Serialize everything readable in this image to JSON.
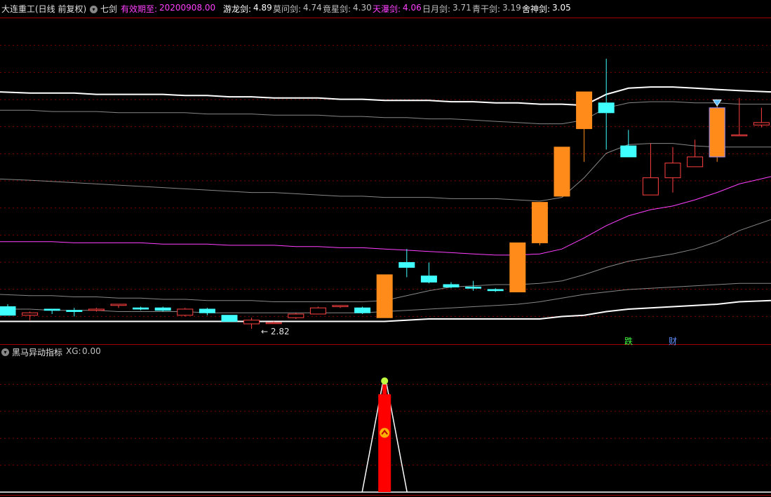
{
  "header": {
    "title": "大连重工(日线 前复权)",
    "indicator_name": "七剑",
    "valid_label": "有效期至:",
    "valid_date": "20200908.00",
    "swords": [
      {
        "label": "游龙剑:",
        "value": "4.89",
        "color": "#ffffff"
      },
      {
        "label": "莫问剑:",
        "value": "4.74",
        "color": "#c0c0c0"
      },
      {
        "label": "竟星剑:",
        "value": "4.30",
        "color": "#c0c0c0"
      },
      {
        "label": "天瀑剑:",
        "value": "4.06",
        "color": "#ff40ff"
      },
      {
        "label": "日月剑:",
        "value": "3.71",
        "color": "#c0c0c0"
      },
      {
        "label": "青干剑:",
        "value": "3.19",
        "color": "#c0c0c0"
      },
      {
        "label": "舍神剑:",
        "value": "3.05",
        "color": "#ffffff"
      }
    ]
  },
  "sub_header": {
    "title": "黑马异动指标",
    "xg_label": "XG:",
    "xg_value": "0.00"
  },
  "annotations": {
    "low_price": "2.82",
    "mark_die": "跌",
    "mark_cai": "财"
  },
  "colors": {
    "up": "#ff4040",
    "down": "#40ffff",
    "strong": "#ff8c1a",
    "magenta": "#ff40ff",
    "grid": "#800000",
    "signal": "#ff0000"
  },
  "chart_data": {
    "type": "candlestick",
    "price_range": [
      2.7,
      5.35
    ],
    "candles": [
      {
        "o": 3.0,
        "h": 3.02,
        "l": 2.93,
        "c": 2.93
      },
      {
        "o": 2.93,
        "h": 2.96,
        "l": 2.89,
        "c": 2.95
      },
      {
        "o": 2.98,
        "h": 2.98,
        "l": 2.94,
        "c": 2.97
      },
      {
        "o": 2.97,
        "h": 2.99,
        "l": 2.92,
        "c": 2.96
      },
      {
        "o": 2.97,
        "h": 2.99,
        "l": 2.96,
        "c": 2.98
      },
      {
        "o": 3.01,
        "h": 3.02,
        "l": 2.99,
        "c": 3.02
      },
      {
        "o": 2.99,
        "h": 3.0,
        "l": 2.97,
        "c": 2.98
      },
      {
        "o": 2.99,
        "h": 3.0,
        "l": 2.96,
        "c": 2.97
      },
      {
        "o": 2.93,
        "h": 2.99,
        "l": 2.92,
        "c": 2.98
      },
      {
        "o": 2.98,
        "h": 2.99,
        "l": 2.93,
        "c": 2.95
      },
      {
        "o": 2.93,
        "h": 2.93,
        "l": 2.88,
        "c": 2.88
      },
      {
        "o": 2.86,
        "h": 2.91,
        "l": 2.82,
        "c": 2.89
      },
      {
        "o": 2.87,
        "h": 2.88,
        "l": 2.86,
        "c": 2.87
      },
      {
        "o": 2.91,
        "h": 2.95,
        "l": 2.9,
        "c": 2.94
      },
      {
        "o": 2.94,
        "h": 3.0,
        "l": 2.94,
        "c": 2.99
      },
      {
        "o": 3.0,
        "h": 3.01,
        "l": 2.99,
        "c": 3.01
      },
      {
        "o": 2.99,
        "h": 3.0,
        "l": 2.94,
        "c": 2.95
      },
      {
        "o": 2.91,
        "h": 3.26,
        "l": 2.91,
        "c": 3.26
      },
      {
        "o": 3.36,
        "h": 3.47,
        "l": 3.24,
        "c": 3.32
      },
      {
        "o": 3.25,
        "h": 3.36,
        "l": 3.19,
        "c": 3.2
      },
      {
        "o": 3.18,
        "h": 3.2,
        "l": 3.15,
        "c": 3.16
      },
      {
        "o": 3.16,
        "h": 3.21,
        "l": 3.13,
        "c": 3.15
      },
      {
        "o": 3.14,
        "h": 3.15,
        "l": 3.12,
        "c": 3.13
      },
      {
        "o": 3.12,
        "h": 3.52,
        "l": 3.12,
        "c": 3.52
      },
      {
        "o": 3.52,
        "h": 3.85,
        "l": 3.5,
        "c": 3.85
      },
      {
        "o": 3.9,
        "h": 4.3,
        "l": 3.9,
        "c": 4.3
      },
      {
        "o": 4.45,
        "h": 4.75,
        "l": 4.18,
        "c": 4.75
      },
      {
        "o": 4.66,
        "h": 5.02,
        "l": 4.28,
        "c": 4.58
      },
      {
        "o": 4.31,
        "h": 4.44,
        "l": 4.22,
        "c": 4.22
      },
      {
        "o": 3.91,
        "h": 4.33,
        "l": 3.91,
        "c": 4.05
      },
      {
        "o": 4.05,
        "h": 4.3,
        "l": 3.93,
        "c": 4.17
      },
      {
        "o": 4.14,
        "h": 4.36,
        "l": 4.14,
        "c": 4.22
      },
      {
        "o": 4.22,
        "h": 4.64,
        "l": 4.18,
        "c": 4.62
      },
      {
        "o": 4.4,
        "h": 4.7,
        "l": 4.4,
        "c": 4.4
      },
      {
        "o": 4.48,
        "h": 4.62,
        "l": 4.46,
        "c": 4.5
      }
    ],
    "bands": [
      {
        "name": "游龙剑",
        "color": "#ffffff",
        "width": 2,
        "values": [
          4.75,
          4.74,
          4.74,
          4.74,
          4.73,
          4.73,
          4.73,
          4.73,
          4.72,
          4.72,
          4.71,
          4.71,
          4.7,
          4.7,
          4.7,
          4.69,
          4.69,
          4.68,
          4.68,
          4.68,
          4.67,
          4.67,
          4.66,
          4.66,
          4.65,
          4.65,
          4.64,
          4.73,
          4.78,
          4.79,
          4.79,
          4.78,
          4.77,
          4.76,
          4.75
        ]
      },
      {
        "name": "莫问剑",
        "color": "#c0c0c0",
        "width": 1,
        "values": [
          4.6,
          4.6,
          4.59,
          4.59,
          4.59,
          4.58,
          4.58,
          4.58,
          4.58,
          4.57,
          4.57,
          4.57,
          4.56,
          4.56,
          4.56,
          4.55,
          4.55,
          4.54,
          4.54,
          4.53,
          4.53,
          4.52,
          4.51,
          4.5,
          4.49,
          4.49,
          4.52,
          4.62,
          4.66,
          4.67,
          4.67,
          4.66,
          4.66,
          4.65,
          4.65
        ]
      },
      {
        "name": "竟星剑",
        "color": "#c0c0c0",
        "width": 1,
        "values": [
          4.04,
          4.03,
          4.02,
          4.01,
          4.0,
          3.99,
          3.98,
          3.97,
          3.96,
          3.95,
          3.94,
          3.93,
          3.93,
          3.92,
          3.91,
          3.9,
          3.9,
          3.89,
          3.89,
          3.89,
          3.88,
          3.88,
          3.88,
          3.87,
          3.86,
          3.89,
          4.05,
          4.25,
          4.32,
          4.33,
          4.33,
          4.31,
          4.3,
          4.3,
          4.3
        ]
      },
      {
        "name": "天瀑剑",
        "color": "#ff40ff",
        "width": 1,
        "values": [
          3.53,
          3.53,
          3.53,
          3.52,
          3.52,
          3.52,
          3.52,
          3.51,
          3.51,
          3.51,
          3.5,
          3.5,
          3.5,
          3.49,
          3.49,
          3.48,
          3.48,
          3.47,
          3.46,
          3.45,
          3.44,
          3.43,
          3.42,
          3.42,
          3.43,
          3.47,
          3.56,
          3.66,
          3.74,
          3.79,
          3.82,
          3.87,
          3.93,
          4.0,
          4.06
        ]
      },
      {
        "name": "日月剑",
        "color": "#c0c0c0",
        "width": 1,
        "values": [
          3.1,
          3.09,
          3.09,
          3.08,
          3.08,
          3.07,
          3.07,
          3.06,
          3.06,
          3.05,
          3.05,
          3.05,
          3.04,
          3.04,
          3.04,
          3.04,
          3.04,
          3.05,
          3.09,
          3.13,
          3.16,
          3.17,
          3.18,
          3.18,
          3.19,
          3.21,
          3.26,
          3.32,
          3.37,
          3.4,
          3.43,
          3.47,
          3.53,
          3.62,
          3.71
        ]
      },
      {
        "name": "青干剑",
        "color": "#c0c0c0",
        "width": 1,
        "values": [
          2.98,
          2.98,
          2.97,
          2.97,
          2.97,
          2.96,
          2.96,
          2.96,
          2.96,
          2.95,
          2.95,
          2.95,
          2.95,
          2.95,
          2.95,
          2.95,
          2.95,
          2.96,
          2.97,
          2.98,
          2.99,
          3.0,
          3.01,
          3.02,
          3.04,
          3.07,
          3.1,
          3.12,
          3.14,
          3.15,
          3.16,
          3.17,
          3.18,
          3.19,
          3.19
        ]
      },
      {
        "name": "舍神剑",
        "color": "#ffffff",
        "width": 2,
        "values": [
          2.88,
          2.88,
          2.88,
          2.88,
          2.88,
          2.88,
          2.88,
          2.88,
          2.88,
          2.88,
          2.88,
          2.88,
          2.88,
          2.88,
          2.88,
          2.88,
          2.88,
          2.88,
          2.89,
          2.9,
          2.9,
          2.9,
          2.9,
          2.9,
          2.9,
          2.92,
          2.93,
          2.96,
          2.98,
          2.99,
          3.0,
          3.01,
          3.02,
          3.04,
          3.05
        ]
      }
    ],
    "signal": {
      "index": 17,
      "value": 1.0,
      "range": [
        0,
        1.25
      ]
    }
  }
}
